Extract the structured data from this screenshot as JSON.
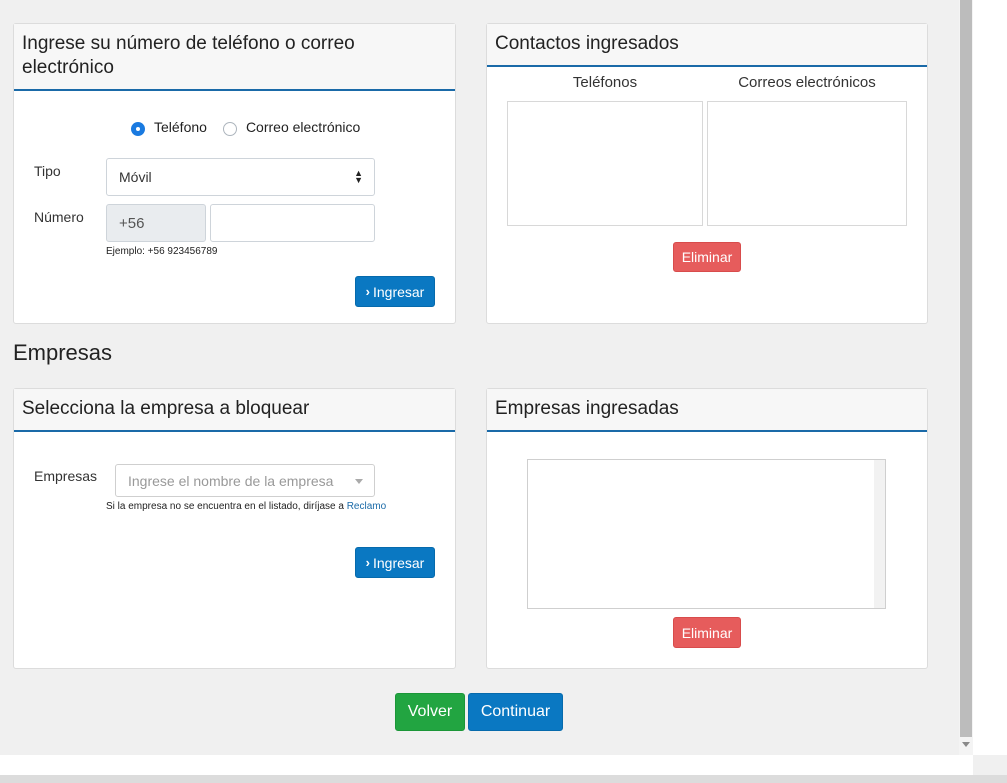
{
  "contact_form": {
    "title": "Ingrese su número de teléfono o correo electrónico",
    "radio_phone": "Teléfono",
    "radio_email": "Correo electrónico",
    "selected_radio": "phone",
    "type_label": "Tipo",
    "type_value": "Móvil",
    "number_label": "Número",
    "prefix": "+56",
    "number_value": "",
    "example": "Ejemplo: +56 923456789",
    "submit_label": "Ingresar"
  },
  "contacts_panel": {
    "title": "Contactos ingresados",
    "phones_header": "Teléfonos",
    "emails_header": "Correos electrónicos",
    "delete_label": "Eliminar"
  },
  "companies_section": {
    "title": "Empresas"
  },
  "company_form": {
    "title": "Selecciona la empresa a bloquear",
    "label": "Empresas",
    "placeholder": "Ingrese el nombre de la empresa",
    "help_text": "Si la empresa no se encuentra en el listado, diríjase a",
    "help_link": "Reclamo",
    "submit_label": "Ingresar"
  },
  "companies_panel": {
    "title": "Empresas ingresadas",
    "delete_label": "Eliminar"
  },
  "footer": {
    "back_label": "Volver",
    "continue_label": "Continuar"
  },
  "colors": {
    "primary": "#0a78c2",
    "danger": "#e65c5c",
    "success": "#22a541",
    "header_rule": "#1a6aa8"
  }
}
